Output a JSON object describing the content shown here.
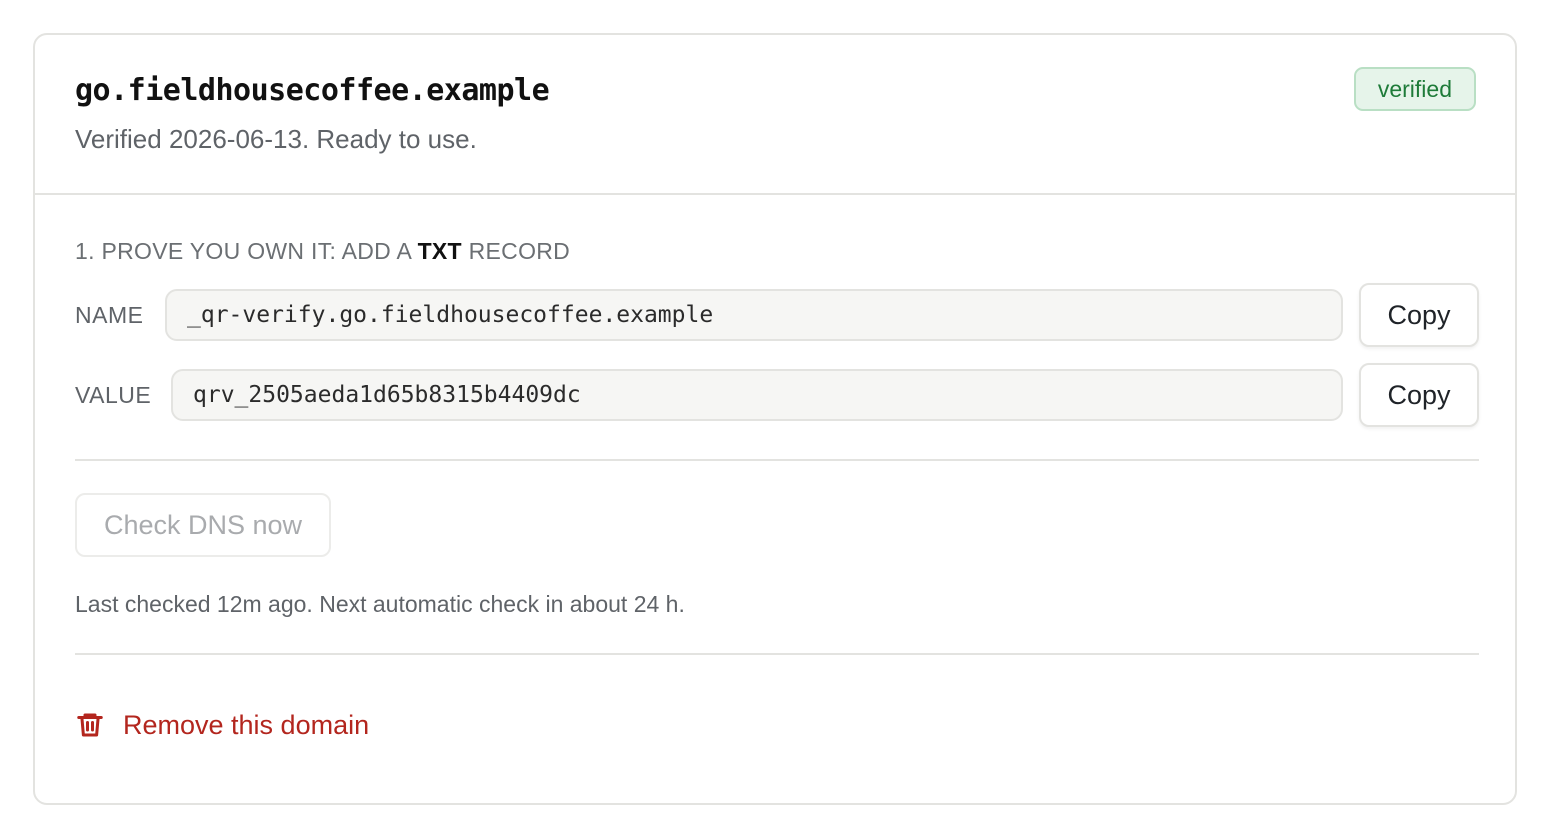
{
  "domain": {
    "name": "go.fieldhousecoffee.example",
    "subtitle": "Verified 2026-06-13. Ready to use.",
    "status": "verified"
  },
  "txt_record": {
    "heading_prefix": "1. PROVE YOU OWN IT: ADD A",
    "heading_type": "TXT",
    "heading_suffix": "RECORD",
    "name_label": "NAME",
    "name_value": "_qr-verify.go.fieldhousecoffee.example",
    "value_label": "VALUE",
    "value_value": "qrv_2505aeda1d65b8315b4409dc",
    "copy_label": "Copy"
  },
  "dns_check": {
    "button_label": "Check DNS now",
    "button_disabled": true,
    "status_text": "Last checked 12m ago. Next automatic check in about 24 h."
  },
  "actions": {
    "remove_label": "Remove this domain",
    "remove_icon": "trash-icon"
  },
  "colors": {
    "verified_text": "#1e7b39",
    "verified_bg": "#e6f4ea",
    "danger": "#b3261e",
    "muted": "#5f6368"
  }
}
